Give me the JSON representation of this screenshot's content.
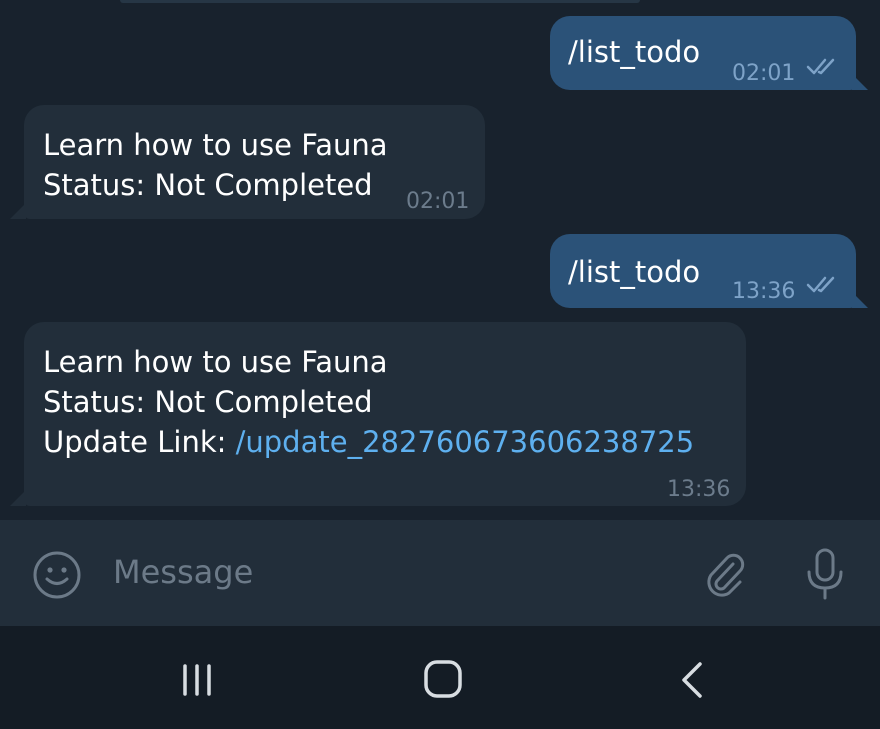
{
  "messages": [
    {
      "direction": "out",
      "text": "/list_todo",
      "time": "02:01",
      "status": "read"
    },
    {
      "direction": "in",
      "lines": [
        "Learn how to use Fauna",
        "Status: Not Completed"
      ],
      "time": "02:01"
    },
    {
      "direction": "out",
      "text": "/list_todo",
      "time": "13:36",
      "status": "read"
    },
    {
      "direction": "in",
      "lines": [
        "Learn how to use Fauna",
        "Status: Not Completed"
      ],
      "link_label": "Update Link: ",
      "link": "/update_282760673606238725",
      "time": "13:36"
    }
  ],
  "composer": {
    "placeholder": "Message",
    "emoji_icon": "emoji-icon",
    "attach_icon": "paperclip-icon",
    "mic_icon": "microphone-icon"
  },
  "navbar": {
    "recent_icon": "recent-apps-icon",
    "home_icon": "home-icon",
    "back_icon": "back-icon"
  },
  "colors": {
    "chat_background": "#18222d",
    "outgoing_bubble": "#2b5278",
    "incoming_bubble": "#222e3a",
    "link": "#5eb0ef",
    "composer_background": "#222e3a",
    "navbar_background": "#141c25"
  }
}
